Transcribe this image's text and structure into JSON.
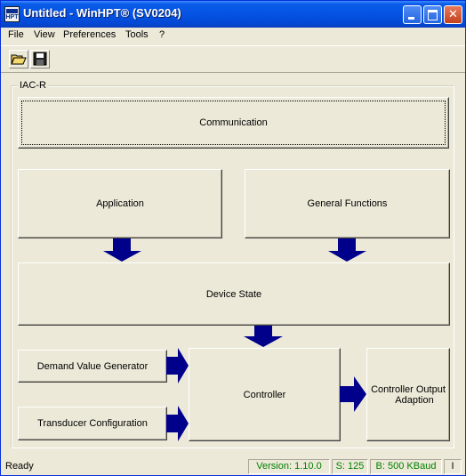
{
  "window": {
    "title": "Untitled - WinHPT® (SV0204)",
    "icon_text": "HPT"
  },
  "menu": [
    "File",
    "View",
    "Preferences",
    "Tools",
    "?"
  ],
  "toolbar": [
    "open-folder-icon",
    "save-disk-icon"
  ],
  "group": {
    "label": "IAC-R"
  },
  "blocks": {
    "communication": "Communication",
    "application": "Application",
    "general_functions": "General Functions",
    "device_state": "Device State",
    "demand_value_generator": "Demand Value Generator",
    "transducer_configuration": "Transducer Configuration",
    "controller": "Controller",
    "controller_output_line1": "Controller Output",
    "controller_output_line2": "Adaption"
  },
  "status": {
    "ready": "Ready",
    "version": "Version: 1.10.0",
    "station": "S: 125",
    "baud": "B: 500 KBaud",
    "mode": "I"
  },
  "colors": {
    "arrow": "#00008b",
    "status_text": "#008000",
    "title_bar": "#0553e3",
    "window_face": "#ece9d8"
  }
}
